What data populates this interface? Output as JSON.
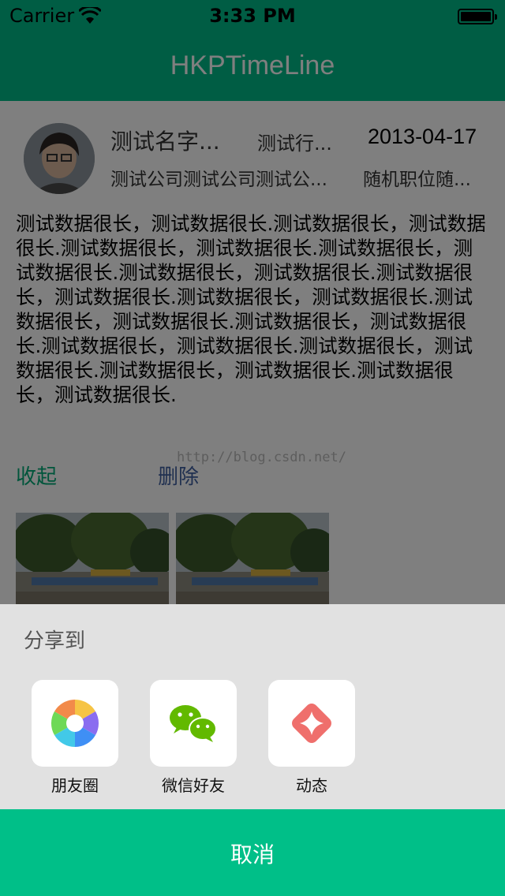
{
  "status_bar": {
    "carrier": "Carrier",
    "time": "3:33 PM"
  },
  "nav": {
    "title": "HKPTimeLine"
  },
  "post": {
    "name": "测试名字...",
    "industry": "测试行...",
    "date": "2013-04-17",
    "company": "测试公司测试公司测试公...",
    "position": "随机职位随...",
    "content": "测试数据很长，测试数据很长.测试数据很长，测试数据很长.测试数据很长，测试数据很长.测试数据很长，测试数据很长.测试数据很长，测试数据很长.测试数据很长，测试数据很长.测试数据很长，测试数据很长.测试数据很长，测试数据很长.测试数据很长，测试数据很长.测试数据很长，测试数据很长.测试数据很长，测试数据很长.测试数据很长，测试数据很长.测试数据很长，测试数据很长.",
    "watermark": "http://blog.csdn.net/",
    "collapse_label": "收起",
    "delete_label": "删除"
  },
  "share_sheet": {
    "title": "分享到",
    "items": [
      {
        "label": "朋友圈",
        "icon": "moments-icon"
      },
      {
        "label": "微信好友",
        "icon": "wechat-icon"
      },
      {
        "label": "动态",
        "icon": "feed-icon"
      }
    ],
    "cancel_label": "取消"
  },
  "colors": {
    "accent": "#00bb88",
    "cancel_bar": "#00bf88",
    "sheet_bg": "#e1e1e1",
    "link_green": "#00aa77",
    "link_blue": "#4060a0"
  }
}
